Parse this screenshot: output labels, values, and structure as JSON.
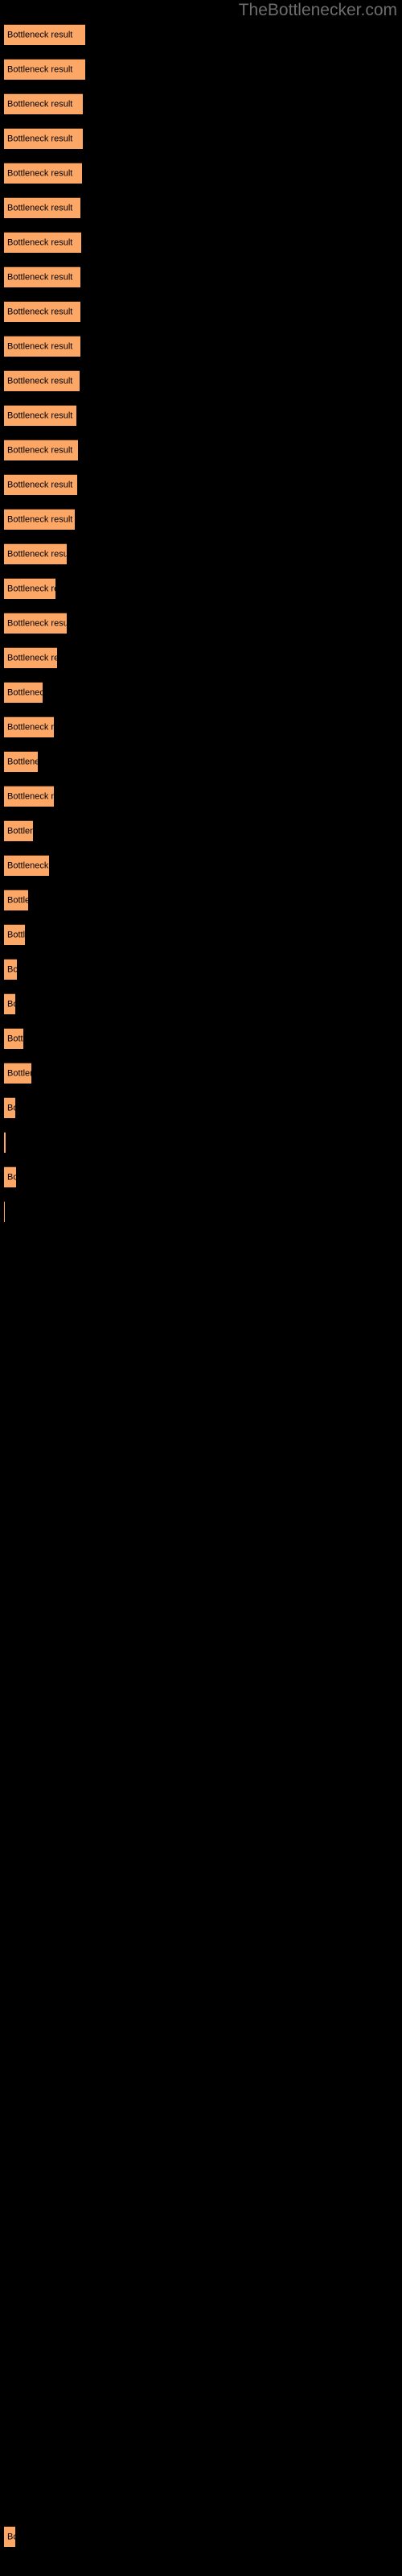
{
  "site": {
    "title": "TheBottlenecker.com"
  },
  "colors": {
    "background": "#000000",
    "bar_fill": "#FDA766",
    "bar_border": "#4A2A14",
    "title_text": "#6D6D6D",
    "label_text": "#000000"
  },
  "chart_data": {
    "type": "bar",
    "orientation": "horizontal",
    "title": "TheBottlenecker.com",
    "xlabel": "",
    "ylabel": "",
    "grid": false,
    "legend": null,
    "bar_label": "Bottleneck result",
    "categories": [
      "Bottleneck result",
      "Bottleneck result",
      "Bottleneck result",
      "Bottleneck result",
      "Bottleneck result",
      "Bottleneck result",
      "Bottleneck result",
      "Bottleneck result",
      "Bottleneck result",
      "Bottleneck result",
      "Bottleneck result",
      "Bottleneck result",
      "Bottleneck result",
      "Bottleneck result",
      "Bottleneck result",
      "Bottleneck result",
      "Bottleneck result",
      "Bottleneck result",
      "Bottleneck result",
      "Bottleneck result",
      "Bottleneck result",
      "Bottleneck result",
      "Bottleneck result",
      "Bottleneck result",
      "Bottleneck result",
      "Bottleneck result",
      "Bottleneck result",
      "Bottleneck result",
      "Bottleneck result",
      "Bottleneck result",
      "Bottleneck result",
      "Bottleneck result",
      "Bottleneck result",
      "Bottleneck result",
      "Bottleneck result",
      "Bottleneck result",
      "Bottleneck result",
      "Bottleneck result",
      "Bottleneck result",
      "Bottleneck result",
      "Bottleneck result",
      "Bottleneck result",
      "Bottleneck result",
      "Bottleneck result",
      "Bottleneck result"
    ],
    "values": [
      101,
      101,
      98,
      98,
      97,
      95,
      96,
      95,
      95,
      95,
      94,
      90,
      92,
      91,
      88,
      78,
      64,
      78,
      66,
      48,
      62,
      42,
      62,
      36,
      56,
      30,
      26,
      16,
      14,
      24,
      34,
      14,
      2,
      15,
      1,
      0,
      0,
      0,
      0,
      0,
      0,
      0,
      0,
      0,
      14
    ],
    "xlim": [
      0,
      101
    ],
    "bars": [
      {
        "y": 30,
        "width": 101,
        "height": 26,
        "label": "Bottleneck result"
      },
      {
        "y": 73,
        "width": 101,
        "height": 26,
        "label": "Bottleneck result"
      },
      {
        "y": 116,
        "width": 98,
        "height": 26,
        "label": "Bottleneck result"
      },
      {
        "y": 159,
        "width": 98,
        "height": 26,
        "label": "Bottleneck result"
      },
      {
        "y": 202,
        "width": 97,
        "height": 26,
        "label": "Bottleneck result"
      },
      {
        "y": 245,
        "width": 95,
        "height": 26,
        "label": "Bottleneck result"
      },
      {
        "y": 288,
        "width": 96,
        "height": 26,
        "label": "Bottleneck result"
      },
      {
        "y": 331,
        "width": 95,
        "height": 26,
        "label": "Bottleneck result"
      },
      {
        "y": 374,
        "width": 95,
        "height": 26,
        "label": "Bottleneck result"
      },
      {
        "y": 417,
        "width": 95,
        "height": 26,
        "label": "Bottleneck result"
      },
      {
        "y": 460,
        "width": 94,
        "height": 26,
        "label": "Bottleneck result"
      },
      {
        "y": 503,
        "width": 90,
        "height": 26,
        "label": "Bottleneck result"
      },
      {
        "y": 546,
        "width": 92,
        "height": 26,
        "label": "Bottleneck result"
      },
      {
        "y": 589,
        "width": 91,
        "height": 26,
        "label": "Bottleneck result"
      },
      {
        "y": 632,
        "width": 88,
        "height": 26,
        "label": "Bottleneck result"
      },
      {
        "y": 675,
        "width": 78,
        "height": 26,
        "label": "Bottleneck result"
      },
      {
        "y": 718,
        "width": 64,
        "height": 26,
        "label": "Bottleneck result"
      },
      {
        "y": 761,
        "width": 78,
        "height": 26,
        "label": "Bottleneck result"
      },
      {
        "y": 804,
        "width": 66,
        "height": 26,
        "label": "Bottleneck result"
      },
      {
        "y": 847,
        "width": 48,
        "height": 26,
        "label": "Bottleneck result"
      },
      {
        "y": 890,
        "width": 62,
        "height": 26,
        "label": "Bottleneck result"
      },
      {
        "y": 933,
        "width": 42,
        "height": 26,
        "label": "Bottleneck result"
      },
      {
        "y": 976,
        "width": 62,
        "height": 26,
        "label": "Bottleneck result"
      },
      {
        "y": 1019,
        "width": 36,
        "height": 26,
        "label": "Bottleneck result"
      },
      {
        "y": 1062,
        "width": 56,
        "height": 26,
        "label": "Bottleneck result"
      },
      {
        "y": 1105,
        "width": 30,
        "height": 26,
        "label": "Bottleneck result"
      },
      {
        "y": 1148,
        "width": 26,
        "height": 26,
        "label": "Bottleneck result"
      },
      {
        "y": 1191,
        "width": 16,
        "height": 26,
        "label": "Bottleneck result"
      },
      {
        "y": 1234,
        "width": 14,
        "height": 26,
        "label": "Bottleneck result"
      },
      {
        "y": 1277,
        "width": 24,
        "height": 26,
        "label": "Bottleneck result"
      },
      {
        "y": 1320,
        "width": 34,
        "height": 26,
        "label": "Bottleneck result"
      },
      {
        "y": 1363,
        "width": 14,
        "height": 26,
        "label": "Bottleneck result"
      },
      {
        "y": 1406,
        "width": 2,
        "height": 26,
        "label": "Bottleneck result"
      },
      {
        "y": 1449,
        "width": 15,
        "height": 26,
        "label": "Bottleneck result"
      },
      {
        "y": 1492,
        "width": 1,
        "height": 26,
        "label": "Bottleneck result"
      },
      {
        "y": 3138,
        "width": 14,
        "height": 26,
        "label": "Bottleneck result"
      }
    ]
  }
}
